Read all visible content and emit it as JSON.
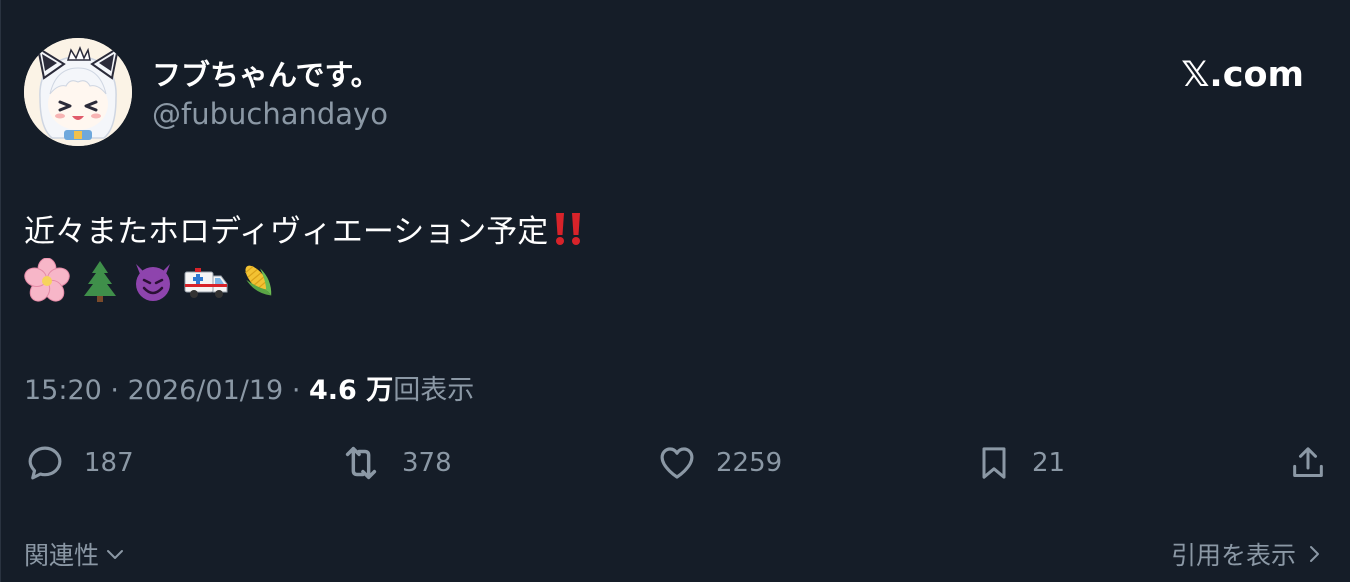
{
  "author": {
    "display_name": "フブちゃんです。",
    "handle": "@fubuchandayo",
    "avatar_icon": "avatar-fubuki-icon"
  },
  "brand": "𝕏.com",
  "tweet": {
    "text": "近々またホロディヴィエーション予定",
    "text_end_emoji": "double-exclamation-icon",
    "emojis": [
      "cherry-blossom-icon",
      "evergreen-tree-icon",
      "smiling-imp-icon",
      "ambulance-icon",
      "corn-icon"
    ]
  },
  "meta": {
    "time": "15:20",
    "separator": "·",
    "date": "2026/01/19",
    "views_value": "4.6 万",
    "views_label": "回表示"
  },
  "actions": {
    "replies": "187",
    "retweets": "378",
    "likes": "2259",
    "bookmarks": "21"
  },
  "footer": {
    "related_label": "関連性",
    "quotes_label": "引用を表示"
  },
  "colors": {
    "background": "#151d28",
    "text_primary": "#ffffff",
    "text_secondary": "#8b98a5"
  }
}
